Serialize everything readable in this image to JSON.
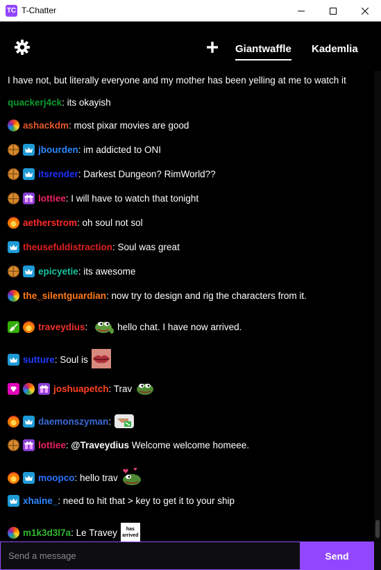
{
  "window": {
    "title": "T-Chatter",
    "icon_text": "TC"
  },
  "header": {
    "tabs": [
      {
        "label": "Giantwaffle",
        "active": true
      },
      {
        "label": "Kademlia",
        "active": false
      }
    ]
  },
  "messages": [
    {
      "user": "",
      "text": "I have not, but literally everyone and my mother has been yelling at me to watch it",
      "color": "#ffffff",
      "badges": []
    },
    {
      "user": "quackerj4ck",
      "text": ": its okayish",
      "color": "#0c9b2d",
      "badges": []
    },
    {
      "user": "ashackdm",
      "text": ": most pixar movies are good",
      "color": "#e2582a",
      "badges": [
        "rainbow"
      ]
    },
    {
      "user": "jbourden",
      "text": ": im addicted to ONI",
      "color": "#2d86ff",
      "badges": [
        "waffle",
        "prime"
      ]
    },
    {
      "user": "itsrender",
      "text": ": Darkest Dungeon? RimWorld??",
      "color": "#1d31ff",
      "badges": [
        "waffle",
        "prime"
      ]
    },
    {
      "user": "lottiee",
      "text": ": I will have to watch that tonight",
      "color": "#ea2460",
      "badges": [
        "waffle",
        "gift"
      ]
    },
    {
      "user": "aetherstrom",
      "text": ": oh soul not sol",
      "color": "#ff2a2a",
      "badges": [
        "flame"
      ]
    },
    {
      "user": "theusefuldistraction",
      "text": ": Soul was great",
      "color": "#e0201f",
      "badges": [
        "prime"
      ]
    },
    {
      "user": "epicyetie",
      "text": ": its awesome",
      "color": "#14c3a0",
      "badges": [
        "waffle",
        "prime"
      ]
    },
    {
      "user": "the_silentguardian",
      "text": ": now try to design and rig the characters from it.",
      "color": "#ff7a1a",
      "badges": [
        "rainbow"
      ]
    },
    {
      "user": "traveydius",
      "text": ": ",
      "after": "hello chat. I have now arrived.",
      "color": "#f0312b",
      "badges": [
        "sword",
        "flame"
      ],
      "emote": "pepe-wave"
    },
    {
      "user": "sutture",
      "text": ": Soul is",
      "color": "#1d3cff",
      "badges": [
        "prime"
      ],
      "emote": "lips"
    },
    {
      "user": "joshuapetch",
      "text": ": Trav",
      "color": "#ff4020",
      "badges": [
        "vip",
        "rainbow",
        "gift"
      ],
      "emote": "pepe"
    },
    {
      "user": "daemonszyman",
      "text": ":",
      "color": "#3a6ad6",
      "badges": [
        "flame",
        "prime"
      ],
      "emote": "hand"
    },
    {
      "user": "lottiee",
      "text": ": ",
      "after": "@Traveydius Welcome welcome homeee.",
      "after_bold": "@Traveydius",
      "color": "#ea2460",
      "badges": [
        "waffle",
        "gift"
      ]
    },
    {
      "user": "moopco",
      "text": ": hello trav",
      "color": "#2c72ff",
      "badges": [
        "flame",
        "prime"
      ],
      "emote": "pepe-love"
    },
    {
      "user": "xhaine_",
      "text": ": need to hit that > key to get it to your ship",
      "color": "#2d86ff",
      "badges": [
        "prime"
      ]
    },
    {
      "user": "m1k3d3l7a",
      "text": ": Le Travey",
      "color": "#2eb82e",
      "badges": [
        "rainbow"
      ],
      "emote": "has-arrived",
      "emote_text": [
        "has",
        "arrived"
      ]
    }
  ],
  "input": {
    "placeholder": "Send a message",
    "value": ""
  },
  "send_label": "Send"
}
